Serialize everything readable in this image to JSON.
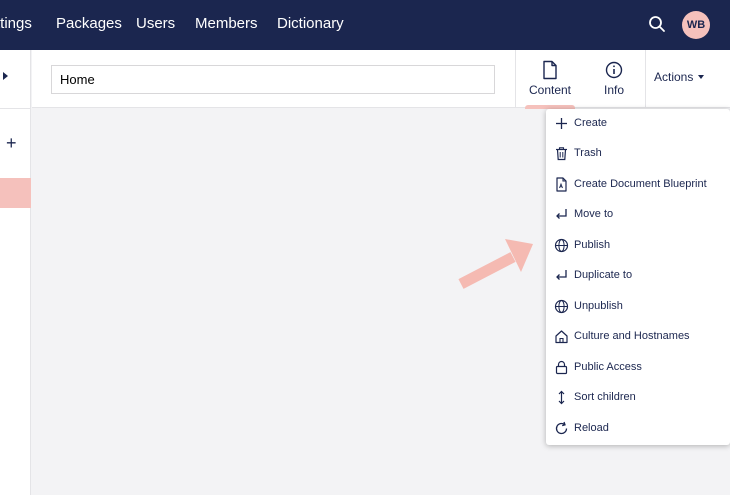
{
  "topnav": {
    "items": [
      "ttings",
      "Packages",
      "Users",
      "Members",
      "Dictionary"
    ],
    "avatar_initials": "WB",
    "colors": {
      "bar": "#1b264f",
      "accent": "#f5c1bc"
    }
  },
  "editor": {
    "name_value": "Home"
  },
  "apps": {
    "content_label": "Content",
    "info_label": "Info",
    "actions_label": "Actions"
  },
  "menu": {
    "items": [
      {
        "label": "Create",
        "icon": "plus-icon"
      },
      {
        "label": "Trash",
        "icon": "trash-icon"
      },
      {
        "label": "Create Document Blueprint",
        "icon": "blueprint-icon"
      },
      {
        "label": "Move to",
        "icon": "move-icon"
      },
      {
        "label": "Publish",
        "icon": "globe-icon"
      },
      {
        "label": "Duplicate to",
        "icon": "duplicate-icon"
      },
      {
        "label": "Unpublish",
        "icon": "globe-icon"
      },
      {
        "label": "Culture and Hostnames",
        "icon": "home-icon"
      },
      {
        "label": "Public Access",
        "icon": "lock-icon"
      },
      {
        "label": "Sort children",
        "icon": "sort-icon"
      },
      {
        "label": "Reload",
        "icon": "reload-icon"
      }
    ]
  }
}
